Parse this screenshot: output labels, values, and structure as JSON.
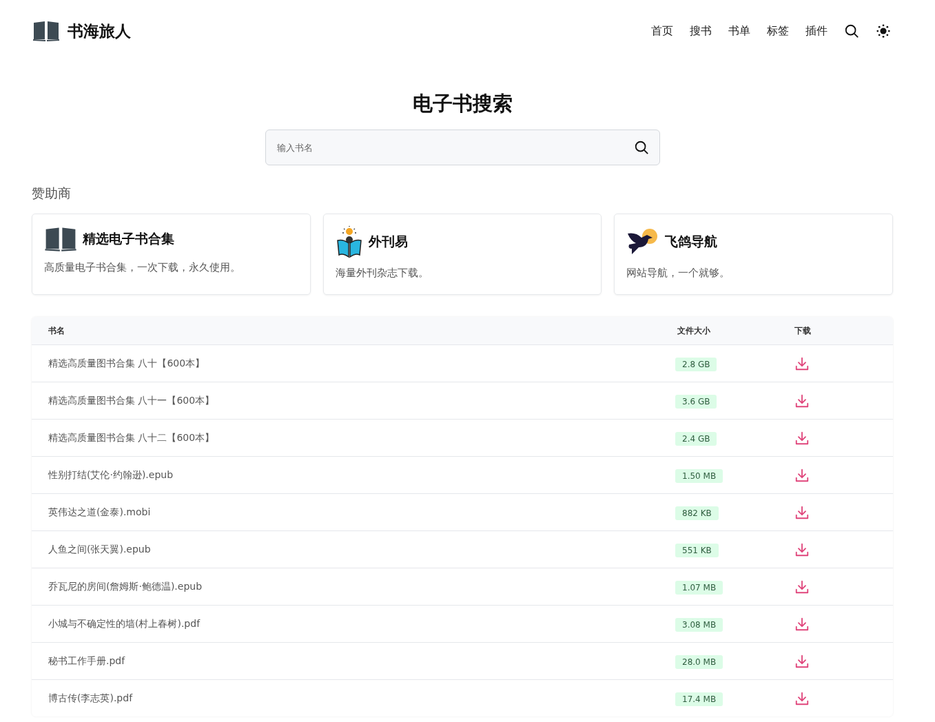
{
  "header": {
    "site_name": "书海旅人",
    "nav": [
      "首页",
      "搜书",
      "书单",
      "标签",
      "插件"
    ]
  },
  "title": "电子书搜索",
  "search": {
    "placeholder": "输入书名"
  },
  "sponsors": {
    "heading": "赞助商",
    "items": [
      {
        "kind": "book",
        "name": "精选电子书合集",
        "description": "高质量电子书合集，一次下载，永久使用。"
      },
      {
        "kind": "reader",
        "name": "外刊易",
        "description": "海量外刊杂志下载。"
      },
      {
        "kind": "bird",
        "name": "飞鸽导航",
        "description": "网站导航，一个就够。"
      }
    ]
  },
  "table": {
    "columns": [
      "书名",
      "文件大小",
      "下载"
    ],
    "rows": [
      {
        "name": "精选高质量图书合集 八十【600本】",
        "size": "2.8 GB"
      },
      {
        "name": "精选高质量图书合集 八十一【600本】",
        "size": "3.6 GB"
      },
      {
        "name": "精选高质量图书合集 八十二【600本】",
        "size": "2.4 GB"
      },
      {
        "name": "性别打结(艾伦·约翰逊).epub",
        "size": "1.50 MB"
      },
      {
        "name": "英伟达之道(金泰).mobi",
        "size": "882 KB"
      },
      {
        "name": "人鱼之间(张天翼).epub",
        "size": "551 KB"
      },
      {
        "name": "乔瓦尼的房间(詹姆斯·鲍德温).epub",
        "size": "1.07 MB"
      },
      {
        "name": "小城与不确定性的墙(村上春树).pdf",
        "size": "3.08 MB"
      },
      {
        "name": "秘书工作手册.pdf",
        "size": "28.0 MB"
      },
      {
        "name": "博古传(李志英).pdf",
        "size": "17.4 MB"
      }
    ]
  }
}
